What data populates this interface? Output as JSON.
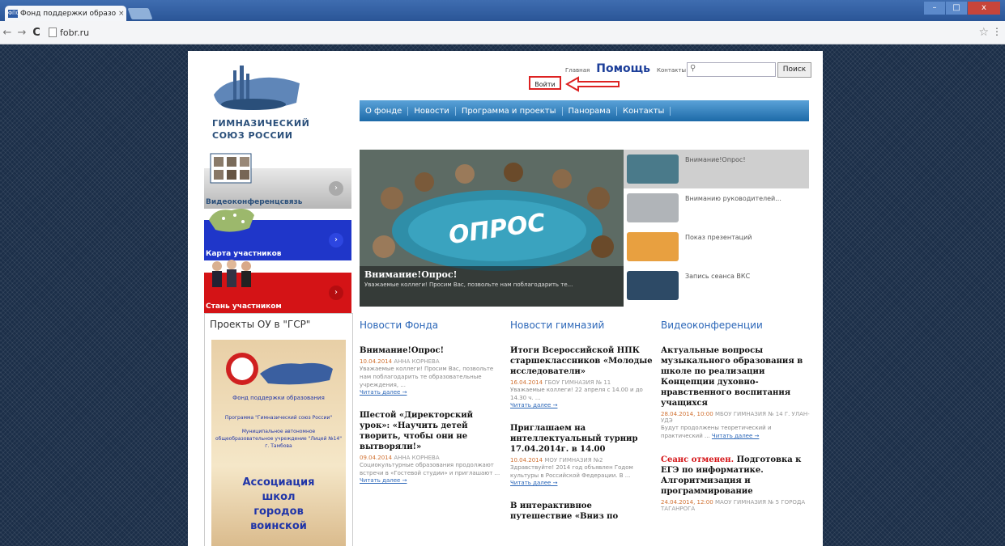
{
  "browser": {
    "tab_title": "Фонд поддержки образо",
    "favicon_text": "ФПО",
    "tab_close": "×",
    "window_buttons": [
      "–",
      "□",
      "x"
    ],
    "url": "fobr.ru",
    "nav_back": "←",
    "nav_forward": "→",
    "nav_reload": "C"
  },
  "header": {
    "logo_text_line1": "ГИМНАЗИЧЕСКИЙ",
    "logo_text_line2": "СОЮЗ РОССИИ",
    "link_home": "Главная",
    "link_help": "Помощь",
    "link_contacts": "Контакты",
    "search_placeholder": "",
    "search_button": "Поиск",
    "login": "Войти"
  },
  "nav": [
    "О фонде",
    "Новости",
    "Программа и проекты",
    "Панорама",
    "Контакты"
  ],
  "banners": {
    "videoconf": "Видеоконференцсвязь",
    "map": "Карта участников",
    "join": "Стань участником",
    "arrow": "›"
  },
  "hero": {
    "image_text": "ОПРОС",
    "title": "Внимание!Опрос!",
    "subtitle": "Уважаемые коллеги! Просим Вас, позвольте нам поблагодарить те..."
  },
  "side_items": [
    "Внимание!Опрос!",
    "Вниманию руководителей...",
    "Показ презентаций",
    "Запись сеанса ВКС"
  ],
  "projects": {
    "title": "Проекты ОУ в \"ГСР\"",
    "org": "Фонд поддержки образования",
    "program": "Программа \"Гимназический союз России\"",
    "school": "Муниципальное автономное общеобразовательное учреждение \"Лицей №14\" г. Тамбова",
    "big_lines": [
      "Ассоциация",
      "школ",
      "городов",
      "воинской"
    ]
  },
  "columns": [
    {
      "title": "Новости Фонда",
      "articles": [
        {
          "title": "Внимание!Опрос!",
          "date": "10.04.2014",
          "author": "АННА КОРНЕВА",
          "body": "Уважаемые коллеги! Просим Вас, позвольте нам поблагодарить те образовательные учреждения, ...",
          "more": "Читать далее →"
        },
        {
          "title": "Шестой «Директорский урок»: «Научить детей творить, чтобы они не вытворяли!»",
          "date": "09.04.2014",
          "author": "АННА КОРНЕВА",
          "body": "Социокультурные образования продолжают встречи в «Гостевой студии» и приглашают ...",
          "more": "Читать далее →"
        }
      ]
    },
    {
      "title": "Новости гимназий",
      "articles": [
        {
          "title": "Итоги Всероссийской НПК старшеклассников «Молодые исследователи»",
          "date": "16.04.2014",
          "author": "ГБОУ ГИМНАЗИЯ № 11",
          "body": "Уважаемые коллеги! 22 апреля с 14.00 и до 14.30 ч. ...",
          "more": "Читать далее →"
        },
        {
          "title": "Приглашаем на интеллектуальный турнир 17.04.2014г. в 14.00",
          "date": "10.04.2014",
          "author": "МОУ ГИМНАЗИЯ №2",
          "body": "Здравствуйте! 2014 год объявлен Годом культуры в Российской Федерации. В ...",
          "more": "Читать далее →"
        },
        {
          "title": "В интерактивное путешествие «Вниз по",
          "date": "",
          "author": "",
          "body": "",
          "more": ""
        }
      ]
    },
    {
      "title": "Видеоконференции",
      "articles": [
        {
          "title": "Актуальные вопросы музыкального образования в школе по реализации Концепции духовно-нравственного воспитания учащихся",
          "title_red": "",
          "date": "28.04.2014, 10:00",
          "author": "МБОУ ГИМНАЗИЯ № 14 Г. УЛАН-УДЭ",
          "body": "Будут продолжены теоретический и практический ...",
          "more": "Читать далее →"
        },
        {
          "title": "Подготовка к ЕГЭ по информатике. Алгоритмизация и программирование",
          "title_red": "Сеанс отменен.",
          "date": "24.04.2014, 12:00",
          "author": "МАОУ ГИМНАЗИЯ № 5 ГОРОДА ТАГАНРОГА",
          "body": "",
          "more": ""
        }
      ]
    }
  ]
}
